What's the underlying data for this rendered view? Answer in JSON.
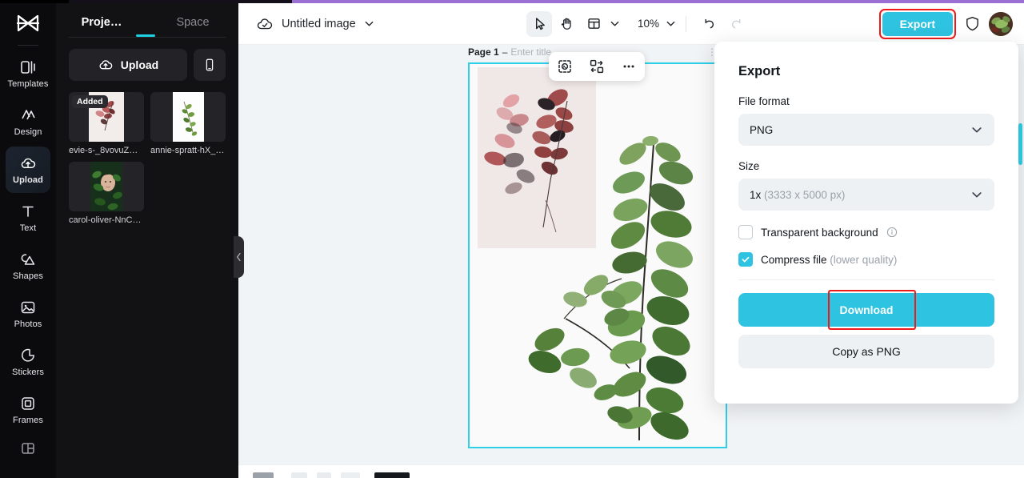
{
  "app": {
    "logo_icon": "capcut-logo-icon"
  },
  "rail": {
    "items": [
      {
        "label": "Templates",
        "icon": "templates-icon",
        "active": false
      },
      {
        "label": "Design",
        "icon": "design-icon",
        "active": false
      },
      {
        "label": "Upload",
        "icon": "upload-cloud-icon",
        "active": true
      },
      {
        "label": "Text",
        "icon": "text-icon",
        "active": false
      },
      {
        "label": "Shapes",
        "icon": "shapes-icon",
        "active": false
      },
      {
        "label": "Photos",
        "icon": "photos-icon",
        "active": false
      },
      {
        "label": "Stickers",
        "icon": "stickers-icon",
        "active": false
      },
      {
        "label": "Frames",
        "icon": "frames-icon",
        "active": false
      },
      {
        "label": "",
        "icon": "layouts-icon",
        "active": false
      }
    ]
  },
  "panel": {
    "tabs": [
      {
        "label": "Proje…",
        "active": true
      },
      {
        "label": "Space",
        "active": false
      }
    ],
    "upload_button": "Upload",
    "phone_button_icon": "phone-icon",
    "thumbnails": [
      {
        "name": "evie-s-_8vovuZ…",
        "badge": "Added"
      },
      {
        "name": "annie-spratt-hX_…",
        "badge": ""
      },
      {
        "name": "carol-oliver-NnC…",
        "badge": ""
      }
    ],
    "collapse_icon": "chevron-left-icon"
  },
  "toolbar": {
    "cloud_icon": "cloud-saved-icon",
    "doc_title": "Untitled image",
    "title_caret_icon": "chevron-down-icon",
    "tools": [
      {
        "icon": "cursor-select-icon",
        "active": true
      },
      {
        "icon": "hand-pan-icon",
        "active": false
      },
      {
        "icon": "layout-grid-icon",
        "active": false
      }
    ],
    "layout_caret_icon": "chevron-down-icon",
    "zoom_level": "10%",
    "zoom_caret_icon": "chevron-down-icon",
    "undo_icon": "undo-icon",
    "redo_icon": "redo-icon",
    "export_label": "Export",
    "shield_icon": "shield-icon",
    "avatar_icon": "avatar"
  },
  "canvas": {
    "page_number": "Page 1",
    "page_dash": "–",
    "page_title_placeholder": "Enter title",
    "float_tools": [
      {
        "icon": "cutout-auto-icon"
      },
      {
        "icon": "replace-swap-icon"
      },
      {
        "icon": "more-ellipsis-icon"
      }
    ]
  },
  "export_panel": {
    "title": "Export",
    "file_format_label": "File format",
    "file_format_value": "PNG",
    "size_label": "Size",
    "size_value": "1x",
    "size_detail": "(3333 x 5000 px)",
    "transparent_label": "Transparent background",
    "transparent_checked": false,
    "transparent_info_icon": "info-icon",
    "compress_label": "Compress file",
    "compress_detail": "(lower quality)",
    "compress_checked": true,
    "download_label": "Download",
    "copy_label": "Copy as PNG",
    "dropdown_icon": "chevron-down-icon"
  },
  "colors": {
    "accent_cyan": "#2ec3e0",
    "artboard_border": "#2ed0e8",
    "highlight_red": "#ee1b1b",
    "rail_bg": "#0b0b0d",
    "panel_bg": "#121214",
    "canvas_bg": "#f1f4f6",
    "browser_accent": "#9b6fd4"
  }
}
